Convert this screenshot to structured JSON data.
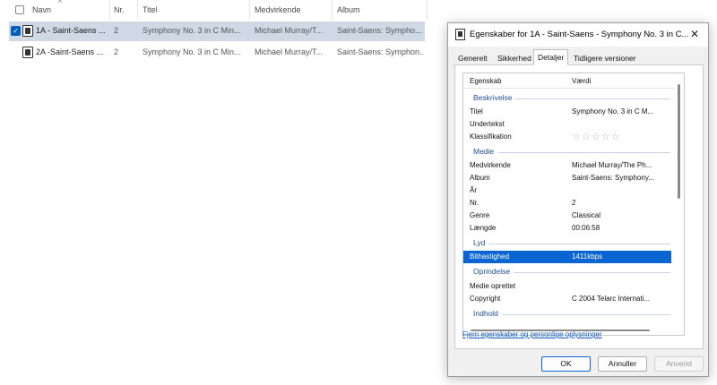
{
  "explorer": {
    "columns": {
      "name": "Navn",
      "nr": "Nr.",
      "title": "Titel",
      "artist": "Medvirkende",
      "album": "Album"
    },
    "rows": [
      {
        "name": "1A - Saint-Saens ...",
        "nr": "2",
        "title": "Symphony No. 3 in C Min...",
        "artist": "Michael Murray/T...",
        "album": "Saint-Saens: Sympho...",
        "selected": true
      },
      {
        "name": "2A -Saint-Saens ...",
        "nr": "2",
        "title": "Symphony No. 3 in C Min...",
        "artist": "Michael Murray/T...",
        "album": "Saint-Saens: Symphon...",
        "selected": false
      }
    ]
  },
  "dialog": {
    "title": "Egenskaber for 1A - Saint-Saens - Symphony No. 3 in C...",
    "close_glyph": "✕",
    "tabs": [
      "Generelt",
      "Sikkerhed",
      "Detaljer",
      "Tidligere versioner"
    ],
    "active_tab": "Detaljer",
    "header_property": "Egenskab",
    "header_value": "Værdi",
    "groups": {
      "description": "Beskrivelse",
      "media": "Medie",
      "sound": "Lyd",
      "origin": "Oprindelse",
      "content": "Indhold"
    },
    "props": {
      "title": {
        "k": "Titel",
        "v": "Symphony No. 3 in C M..."
      },
      "subtitle": {
        "k": "Undertekst",
        "v": ""
      },
      "rating": {
        "k": "Klassifikation",
        "stars": "☆☆☆☆☆",
        "value": 0,
        "max": 5
      },
      "artists": {
        "k": "Medvirkende",
        "v": "Michael Murray/The Ph..."
      },
      "album": {
        "k": "Album",
        "v": "Saint-Saens: Symphony..."
      },
      "year": {
        "k": "År",
        "v": ""
      },
      "nr": {
        "k": "Nr.",
        "v": "2"
      },
      "genre": {
        "k": "Genre",
        "v": "Classical"
      },
      "length": {
        "k": "Længde",
        "v": "00:06:58"
      },
      "bitrate": {
        "k": "Bithastighed",
        "v": "1411kbps"
      },
      "media_created": {
        "k": "Medie oprettet",
        "v": ""
      },
      "copyright": {
        "k": "Copyright",
        "v": "C 2004 Telarc Internati..."
      }
    },
    "remove_link": "Fjern egenskaber og personlige oplysninger",
    "buttons": {
      "ok": "OK",
      "cancel": "Annuller",
      "apply": "Anvend"
    },
    "colors": {
      "selection": "#0a64d2",
      "group_label": "#1f4e9a",
      "link": "#0b57c8"
    }
  }
}
